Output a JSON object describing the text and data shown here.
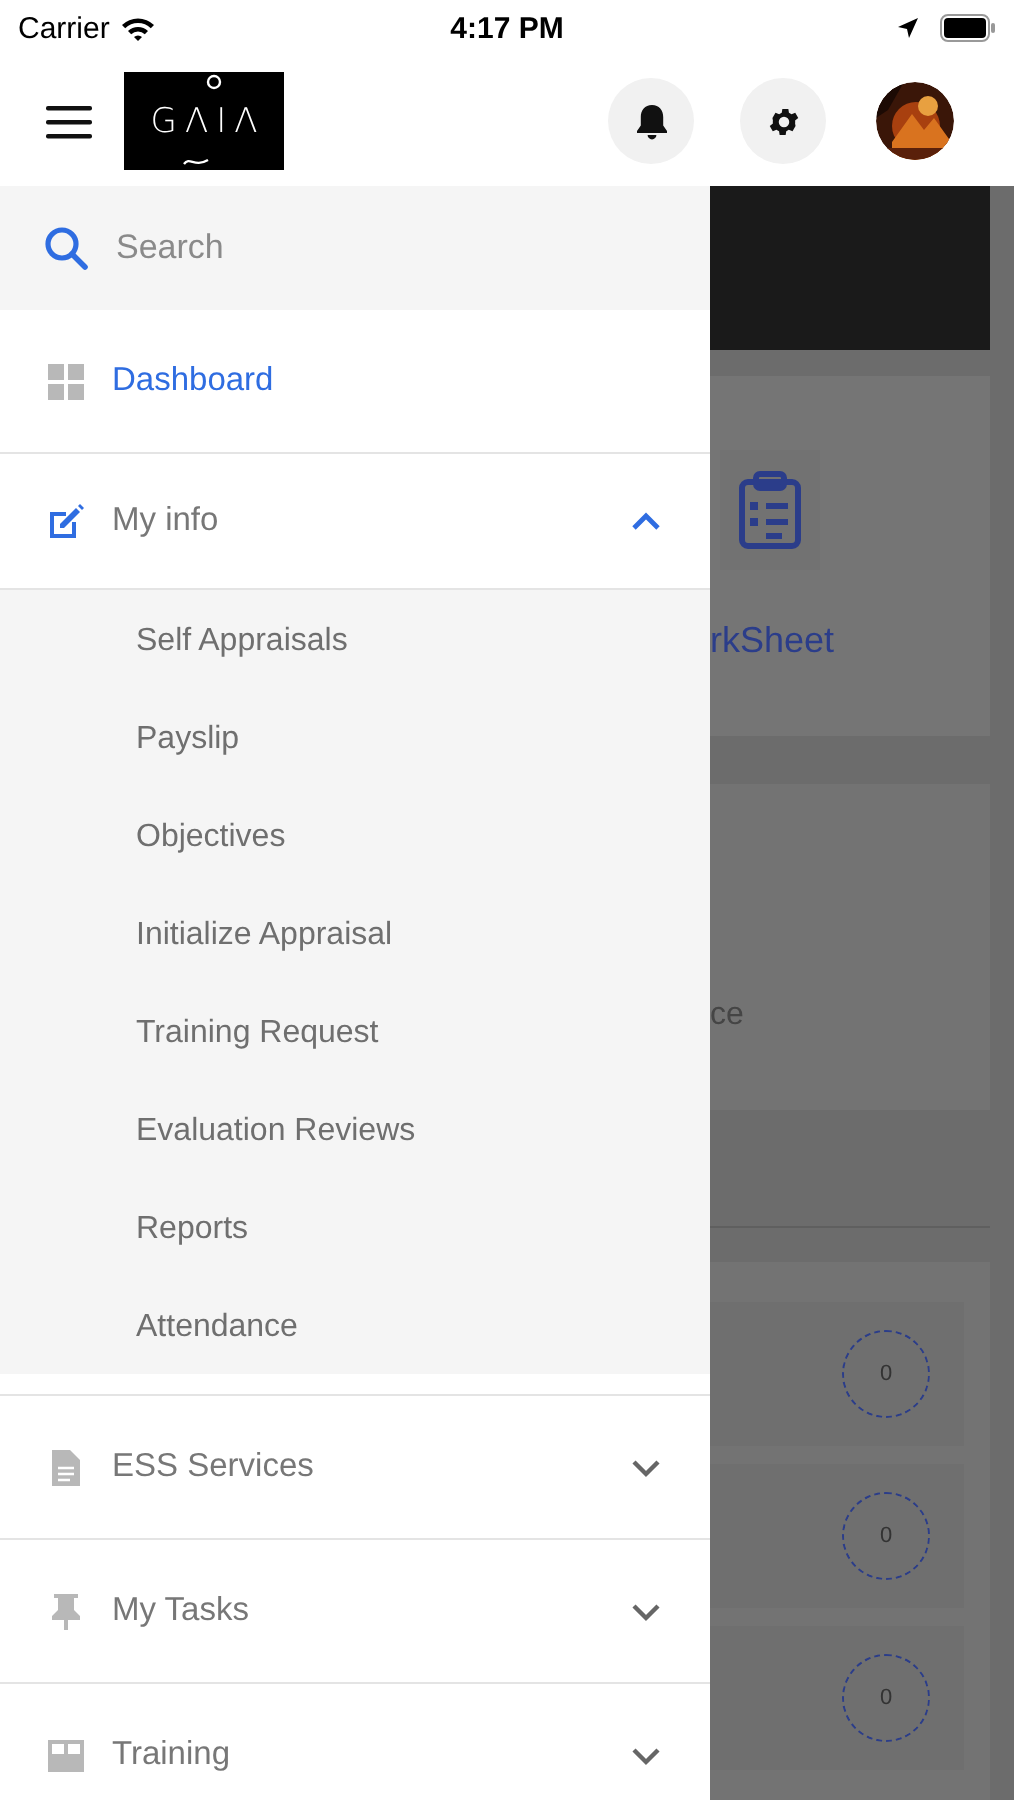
{
  "status_bar": {
    "carrier": "Carrier",
    "time": "4:17 PM"
  },
  "header": {
    "logo": "GΛIΛ"
  },
  "drawer": {
    "search": {
      "placeholder": "Search"
    },
    "items": [
      {
        "kind": "link",
        "label": "Dashboard",
        "selected": true
      },
      {
        "kind": "group",
        "label": "My info",
        "selected": false,
        "expanded": true,
        "children": [
          {
            "label": "Self Appraisals",
            "selected": false
          },
          {
            "label": "Payslip",
            "selected": false
          },
          {
            "label": "Objectives",
            "selected": false
          },
          {
            "label": "Initialize Appraisal",
            "selected": false
          },
          {
            "label": "Training Request",
            "selected": false
          },
          {
            "label": "Evaluation Reviews",
            "selected": false
          },
          {
            "label": "Reports",
            "selected": false
          },
          {
            "label": "Attendance",
            "selected": false
          }
        ]
      },
      {
        "kind": "group",
        "label": "ESS Services",
        "selected": false,
        "expanded": false
      },
      {
        "kind": "group",
        "label": "My Tasks",
        "selected": false,
        "expanded": false
      },
      {
        "kind": "group",
        "label": "Training",
        "selected": false,
        "expanded": false
      }
    ]
  },
  "background": {
    "card_label": "rkSheet",
    "card_text": "ce",
    "counters": [
      "0",
      "0",
      "0"
    ]
  }
}
